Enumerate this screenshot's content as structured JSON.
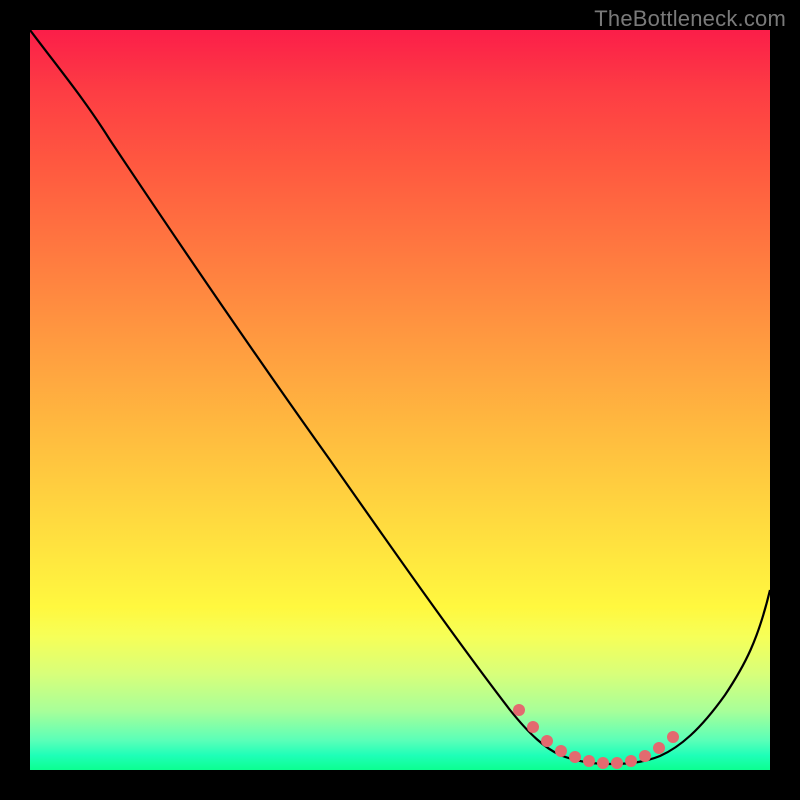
{
  "watermark": "TheBottleneck.com",
  "chart_data": {
    "type": "line",
    "title": "",
    "xlabel": "",
    "ylabel": "",
    "xlim": [
      0,
      100
    ],
    "ylim": [
      0,
      100
    ],
    "series": [
      {
        "name": "bottleneck-curve",
        "x": [
          0,
          5,
          10,
          15,
          20,
          25,
          30,
          35,
          40,
          45,
          50,
          55,
          60,
          65,
          68,
          70,
          72,
          75,
          78,
          80,
          82,
          85,
          88,
          92,
          96,
          100
        ],
        "y": [
          100,
          96,
          91,
          84,
          77,
          70,
          63,
          56,
          49,
          42,
          35,
          28,
          21,
          14,
          9,
          6,
          4,
          2.5,
          2,
          2,
          2.5,
          3.5,
          6,
          11,
          18,
          26
        ]
      },
      {
        "name": "optimal-zone-dots",
        "x": [
          66,
          68,
          70,
          72,
          74,
          76,
          78,
          80,
          82,
          84,
          86
        ],
        "y": [
          9.5,
          7,
          5,
          3.8,
          3,
          2.5,
          2.3,
          2.3,
          2.6,
          3.2,
          4.5
        ]
      }
    ],
    "gradient_description": "vertical red-to-green heat gradient representing bottleneck severity (red=high, green=optimal)",
    "background": "#000000",
    "curve_color": "#000000",
    "dot_color": "#e36a6f"
  }
}
